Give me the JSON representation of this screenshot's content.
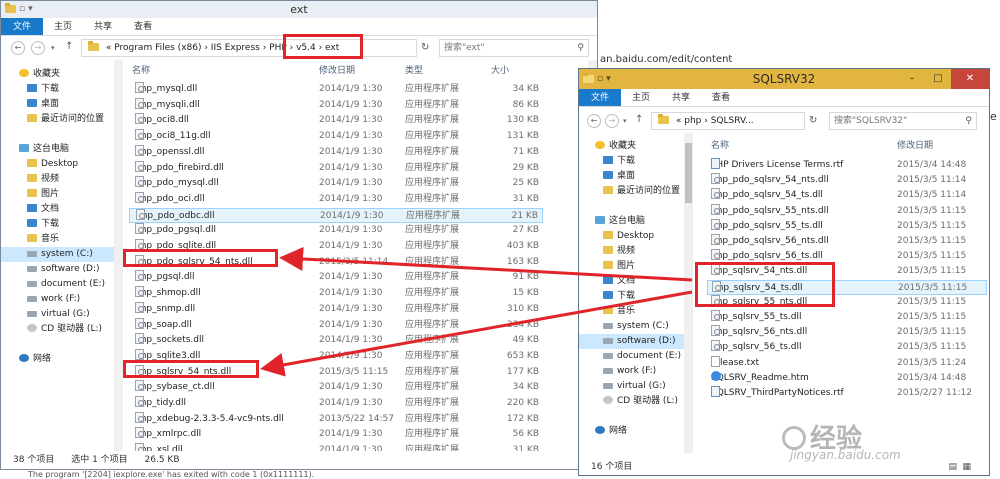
{
  "background": {
    "url_fragment": "an.baidu.com/edit/content",
    "console_line": "The program '[2204] iexplore.exe' has exited with code 1 (0x1111111)."
  },
  "watermark": {
    "logo_text": "经验",
    "url": "jingyan.baidu.com"
  },
  "colors": {
    "ribbon_file": "#1979ca",
    "selection": "#cce8ff",
    "highlight_box": "#e0242a",
    "close_button": "#c7463c"
  },
  "left_window": {
    "title": "ext",
    "ribbon_tabs": [
      "文件",
      "主页",
      "共享",
      "查看"
    ],
    "address_path": "«  Program Files (x86)  ›  IIS Express  ›  PHP  ›  v5.4  ›  ext",
    "search_placeholder": "搜索\"ext\"",
    "nav": [
      {
        "label": "收藏夹",
        "icon": "star-icon"
      },
      {
        "label": "下载",
        "icon": "download-folder-icon"
      },
      {
        "label": "桌面",
        "icon": "desktop-icon"
      },
      {
        "label": "最近访问的位置",
        "icon": "recent-icon"
      },
      {
        "label": "",
        "icon": ""
      },
      {
        "label": "这台电脑",
        "icon": "computer-icon"
      },
      {
        "label": "Desktop",
        "icon": "folder-icon"
      },
      {
        "label": "视频",
        "icon": "video-folder-icon"
      },
      {
        "label": "图片",
        "icon": "pictures-folder-icon"
      },
      {
        "label": "文档",
        "icon": "documents-folder-icon"
      },
      {
        "label": "下载",
        "icon": "download-folder-icon"
      },
      {
        "label": "音乐",
        "icon": "music-folder-icon"
      },
      {
        "label": "system (C:)",
        "icon": "drive-icon"
      },
      {
        "label": "software (D:)",
        "icon": "drive-icon"
      },
      {
        "label": "document (E:)",
        "icon": "drive-icon"
      },
      {
        "label": "work (F:)",
        "icon": "drive-icon"
      },
      {
        "label": "virtual (G:)",
        "icon": "drive-icon"
      },
      {
        "label": "CD 驱动器 (L:)",
        "icon": "cd-drive-icon"
      },
      {
        "label": "",
        "icon": ""
      },
      {
        "label": "网络",
        "icon": "network-icon"
      }
    ],
    "columns": [
      "名称",
      "修改日期",
      "类型",
      "大小"
    ],
    "files": [
      {
        "name": "php_mysql.dll",
        "date": "2014/1/9 1:30",
        "type": "应用程序扩展",
        "size": "34 KB"
      },
      {
        "name": "php_mysqli.dll",
        "date": "2014/1/9 1:30",
        "type": "应用程序扩展",
        "size": "86 KB"
      },
      {
        "name": "php_oci8.dll",
        "date": "2014/1/9 1:30",
        "type": "应用程序扩展",
        "size": "130 KB"
      },
      {
        "name": "php_oci8_11g.dll",
        "date": "2014/1/9 1:30",
        "type": "应用程序扩展",
        "size": "131 KB"
      },
      {
        "name": "php_openssl.dll",
        "date": "2014/1/9 1:30",
        "type": "应用程序扩展",
        "size": "71 KB"
      },
      {
        "name": "php_pdo_firebird.dll",
        "date": "2014/1/9 1:30",
        "type": "应用程序扩展",
        "size": "29 KB"
      },
      {
        "name": "php_pdo_mysql.dll",
        "date": "2014/1/9 1:30",
        "type": "应用程序扩展",
        "size": "25 KB"
      },
      {
        "name": "php_pdo_oci.dll",
        "date": "2014/1/9 1:30",
        "type": "应用程序扩展",
        "size": "31 KB"
      },
      {
        "name": "php_pdo_odbc.dll",
        "date": "2014/1/9 1:30",
        "type": "应用程序扩展",
        "size": "21 KB"
      },
      {
        "name": "php_pdo_pgsql.dll",
        "date": "2014/1/9 1:30",
        "type": "应用程序扩展",
        "size": "27 KB"
      },
      {
        "name": "php_pdo_sqlite.dll",
        "date": "2014/1/9 1:30",
        "type": "应用程序扩展",
        "size": "403 KB"
      },
      {
        "name": "php_pdo_sqlsrv_54_nts.dll",
        "date": "2015/3/5 11:14",
        "type": "应用程序扩展",
        "size": "163 KB"
      },
      {
        "name": "php_pgsql.dll",
        "date": "2014/1/9 1:30",
        "type": "应用程序扩展",
        "size": "91 KB"
      },
      {
        "name": "php_shmop.dll",
        "date": "2014/1/9 1:30",
        "type": "应用程序扩展",
        "size": "15 KB"
      },
      {
        "name": "php_snmp.dll",
        "date": "2014/1/9 1:30",
        "type": "应用程序扩展",
        "size": "310 KB"
      },
      {
        "name": "php_soap.dll",
        "date": "2014/1/9 1:30",
        "type": "应用程序扩展",
        "size": "234 KB"
      },
      {
        "name": "php_sockets.dll",
        "date": "2014/1/9 1:30",
        "type": "应用程序扩展",
        "size": "49 KB"
      },
      {
        "name": "php_sqlite3.dll",
        "date": "2014/1/9 1:30",
        "type": "应用程序扩展",
        "size": "653 KB"
      },
      {
        "name": "php_sqlsrv_54_nts.dll",
        "date": "2015/3/5 11:15",
        "type": "应用程序扩展",
        "size": "177 KB"
      },
      {
        "name": "php_sybase_ct.dll",
        "date": "2014/1/9 1:30",
        "type": "应用程序扩展",
        "size": "34 KB"
      },
      {
        "name": "php_tidy.dll",
        "date": "2014/1/9 1:30",
        "type": "应用程序扩展",
        "size": "220 KB"
      },
      {
        "name": "php_xdebug-2.3.3-5.4-vc9-nts.dll",
        "date": "2013/5/22 14:57",
        "type": "应用程序扩展",
        "size": "172 KB"
      },
      {
        "name": "php_xmlrpc.dll",
        "date": "2014/1/9 1:30",
        "type": "应用程序扩展",
        "size": "56 KB"
      },
      {
        "name": "php_xsl.dll",
        "date": "2014/1/9 1:30",
        "type": "应用程序扩展",
        "size": "31 KB"
      }
    ],
    "selected_index": 8,
    "status": {
      "count": "38 个项目",
      "selected": "选中 1 个项目",
      "size": "26.5 KB"
    }
  },
  "right_window": {
    "title": "SQLSRV32",
    "ribbon_tabs": [
      "文件",
      "主页",
      "共享",
      "查看"
    ],
    "address_path": "«  php  ›  SQLSRV...",
    "search_placeholder": "搜索\"SQLSRV32\"",
    "nav": [
      {
        "label": "收藏夹",
        "icon": "star-icon"
      },
      {
        "label": "下载",
        "icon": "download-folder-icon"
      },
      {
        "label": "桌面",
        "icon": "desktop-icon"
      },
      {
        "label": "最近访问的位置",
        "icon": "recent-icon"
      },
      {
        "label": "",
        "icon": ""
      },
      {
        "label": "这台电脑",
        "icon": "computer-icon"
      },
      {
        "label": "Desktop",
        "icon": "folder-icon"
      },
      {
        "label": "视频",
        "icon": "video-folder-icon"
      },
      {
        "label": "图片",
        "icon": "pictures-folder-icon"
      },
      {
        "label": "文档",
        "icon": "documents-folder-icon"
      },
      {
        "label": "下载",
        "icon": "download-folder-icon"
      },
      {
        "label": "音乐",
        "icon": "music-folder-icon"
      },
      {
        "label": "system (C:)",
        "icon": "drive-icon"
      },
      {
        "label": "software (D:)",
        "icon": "drive-icon"
      },
      {
        "label": "document (E:)",
        "icon": "drive-icon"
      },
      {
        "label": "work (F:)",
        "icon": "drive-icon"
      },
      {
        "label": "virtual (G:)",
        "icon": "drive-icon"
      },
      {
        "label": "CD 驱动器 (L:)",
        "icon": "cd-drive-icon"
      },
      {
        "label": "",
        "icon": ""
      },
      {
        "label": "网络",
        "icon": "network-icon"
      }
    ],
    "columns": [
      "名称",
      "修改日期"
    ],
    "files": [
      {
        "name": "PHP Drivers License Terms.rtf",
        "date": "2015/3/4 14:48",
        "icon": "rtf"
      },
      {
        "name": "php_pdo_sqlsrv_54_nts.dll",
        "date": "2015/3/5 11:14",
        "icon": "dll"
      },
      {
        "name": "php_pdo_sqlsrv_54_ts.dll",
        "date": "2015/3/5 11:14",
        "icon": "dll"
      },
      {
        "name": "php_pdo_sqlsrv_55_nts.dll",
        "date": "2015/3/5 11:15",
        "icon": "dll"
      },
      {
        "name": "php_pdo_sqlsrv_55_ts.dll",
        "date": "2015/3/5 11:15",
        "icon": "dll"
      },
      {
        "name": "php_pdo_sqlsrv_56_nts.dll",
        "date": "2015/3/5 11:15",
        "icon": "dll"
      },
      {
        "name": "php_pdo_sqlsrv_56_ts.dll",
        "date": "2015/3/5 11:15",
        "icon": "dll"
      },
      {
        "name": "php_sqlsrv_54_nts.dll",
        "date": "2015/3/5 11:15",
        "icon": "dll"
      },
      {
        "name": "php_sqlsrv_54_ts.dll",
        "date": "2015/3/5 11:15",
        "icon": "dll"
      },
      {
        "name": "php_sqlsrv_55_nts.dll",
        "date": "2015/3/5 11:15",
        "icon": "dll"
      },
      {
        "name": "php_sqlsrv_55_ts.dll",
        "date": "2015/3/5 11:15",
        "icon": "dll"
      },
      {
        "name": "php_sqlsrv_56_nts.dll",
        "date": "2015/3/5 11:15",
        "icon": "dll"
      },
      {
        "name": "php_sqlsrv_56_ts.dll",
        "date": "2015/3/5 11:15",
        "icon": "dll"
      },
      {
        "name": "release.txt",
        "date": "2015/3/5 11:24",
        "icon": "txt"
      },
      {
        "name": "SQLSRV_Readme.htm",
        "date": "2015/3/4 14:48",
        "icon": "htm"
      },
      {
        "name": "SQLSRV_ThirdPartyNotices.rtf",
        "date": "2015/2/27 11:12",
        "icon": "rtf"
      }
    ],
    "selected_index": 8,
    "status": {
      "count": "16 个项目"
    }
  }
}
